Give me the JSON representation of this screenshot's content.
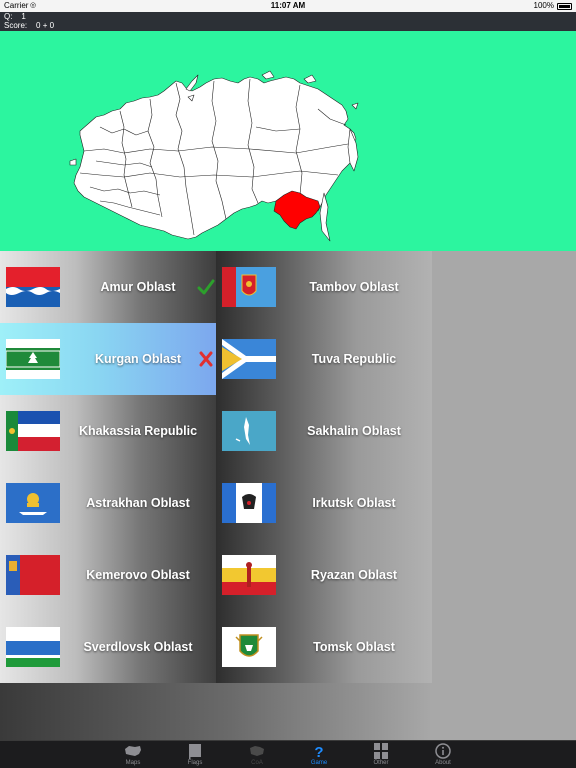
{
  "status_bar": {
    "carrier": "Carrier",
    "time": "11:07 AM",
    "battery": "100%"
  },
  "quiz": {
    "q_label": "Q:",
    "q_value": "1",
    "score_label": "Score:",
    "score_value": "0 + 0"
  },
  "map": {
    "background": "#2cf59f",
    "highlight_color": "#ff0000",
    "highlighted_region": "Amur Oblast"
  },
  "flags_left": [
    {
      "name": "Amur Oblast",
      "state": "correct",
      "mark": "check-icon"
    },
    {
      "name": "Kurgan Oblast",
      "state": "wrong",
      "mark": "cross-icon",
      "selected": true
    },
    {
      "name": "Khakassia Republic"
    },
    {
      "name": "Astrakhan Oblast"
    },
    {
      "name": "Kemerovo Oblast"
    },
    {
      "name": "Sverdlovsk Oblast"
    }
  ],
  "flags_right": [
    {
      "name": "Tambov Oblast"
    },
    {
      "name": "Tuva Republic"
    },
    {
      "name": "Sakhalin Oblast"
    },
    {
      "name": "Irkutsk Oblast"
    },
    {
      "name": "Ryazan Oblast"
    },
    {
      "name": "Tomsk Oblast"
    }
  ],
  "tabs": [
    {
      "label": "Maps",
      "icon": "map-icon"
    },
    {
      "label": "Flags",
      "icon": "flag-icon"
    },
    {
      "label": "CoA",
      "icon": "coat-of-arms-icon",
      "disabled": true
    },
    {
      "label": "Game",
      "icon": "question-icon",
      "active": true
    },
    {
      "label": "Other",
      "icon": "grid-icon"
    },
    {
      "label": "About",
      "icon": "info-icon"
    }
  ],
  "colors": {
    "accent": "#1e8cff",
    "correct": "#2ca02c",
    "wrong": "#e03030"
  }
}
